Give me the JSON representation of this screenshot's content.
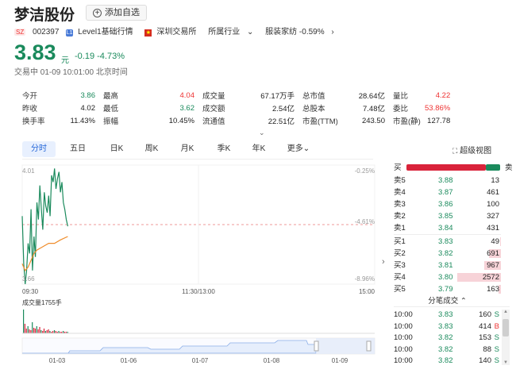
{
  "header": {
    "title": "梦洁股份",
    "watch_label": "添加自选",
    "market_tag": "SZ",
    "code": "002397",
    "level_badge": "L1",
    "level_label": "Level1基础行情",
    "exchange_label": "深圳交易所",
    "industry_label": "所属行业",
    "sector_label": "服装家纺 -0.59%"
  },
  "quote": {
    "price": "3.83",
    "unit": "元",
    "change": "-0.19  -4.73%",
    "timestamp": "交易中 01-09 10:01:00 北京时间"
  },
  "stats": [
    [
      {
        "l": "今开",
        "v": "3.86",
        "c": "grn"
      },
      {
        "l": "最高",
        "v": "4.04",
        "c": "red"
      },
      {
        "l": "成交量",
        "v": "67.17万手",
        "c": ""
      },
      {
        "l": "总市值",
        "v": "28.64亿",
        "c": ""
      },
      {
        "l": "量比",
        "v": "4.22",
        "c": "red"
      }
    ],
    [
      {
        "l": "昨收",
        "v": "4.02",
        "c": ""
      },
      {
        "l": "最低",
        "v": "3.62",
        "c": "grn"
      },
      {
        "l": "成交额",
        "v": "2.54亿",
        "c": ""
      },
      {
        "l": "总股本",
        "v": "7.48亿",
        "c": ""
      },
      {
        "l": "委比",
        "v": "53.86%",
        "c": "red"
      }
    ],
    [
      {
        "l": "换手率",
        "v": "11.43%",
        "c": ""
      },
      {
        "l": "振幅",
        "v": "10.45%",
        "c": ""
      },
      {
        "l": "流通值",
        "v": "22.51亿",
        "c": ""
      },
      {
        "l": "市盈(TTM)",
        "v": "243.50",
        "c": ""
      },
      {
        "l": "市盈(静)",
        "v": "127.78",
        "c": ""
      }
    ]
  ],
  "tabs": [
    "分时",
    "五日",
    "日K",
    "周K",
    "月K",
    "季K",
    "年K",
    "更多"
  ],
  "super_chart_label": "超级视图",
  "chart": {
    "y_top": "4.01",
    "y_bottom": "3.66",
    "pct_top": "-0.25%",
    "pct_mid": "-4.61%",
    "pct_bottom": "-8.96%",
    "x_start": "09:30",
    "x_mid": "11:30/13:00",
    "x_end": "15:00",
    "volume_label": "成交量1755手",
    "nav_dates": [
      "01-03",
      "01-06",
      "01-07",
      "01-08",
      "01-09"
    ]
  },
  "chart_data": {
    "type": "line",
    "series": [
      {
        "color": "#1a8a5c",
        "x": [
          "09:30",
          "09:31",
          "09:32",
          "09:33",
          "09:34",
          "09:35",
          "09:36",
          "09:37",
          "09:38",
          "09:39",
          "09:40",
          "09:41",
          "09:42",
          "09:43",
          "09:44",
          "09:45",
          "09:46",
          "09:47",
          "09:48",
          "09:49",
          "09:50",
          "09:51",
          "09:52",
          "09:53",
          "09:54",
          "09:55",
          "09:56",
          "09:57",
          "09:58",
          "09:59",
          "10:00",
          "10:01"
        ],
        "values": [
          3.86,
          3.72,
          3.66,
          3.7,
          3.78,
          3.75,
          3.88,
          3.7,
          3.8,
          3.74,
          3.9,
          3.85,
          3.95,
          3.88,
          3.82,
          3.93,
          3.89,
          3.87,
          3.92,
          3.86,
          3.98,
          3.96,
          4.0,
          3.94,
          3.97,
          3.99,
          3.93,
          3.96,
          3.9,
          3.88,
          3.85,
          3.83
        ]
      },
      {
        "color": "#f08c2a",
        "x": [
          "09:30",
          "09:32",
          "09:34",
          "09:36",
          "09:38",
          "09:40",
          "09:44",
          "09:48",
          "09:52",
          "09:56",
          "10:01"
        ],
        "values": [
          3.72,
          3.7,
          3.71,
          3.73,
          3.75,
          3.76,
          3.77,
          3.78,
          3.78,
          3.79,
          3.8
        ]
      }
    ],
    "ylim": [
      3.66,
      4.01
    ]
  },
  "order_book": {
    "header_left": "买",
    "header_right": "卖",
    "asks": [
      {
        "label": "卖5",
        "price": "3.88",
        "vol": "13"
      },
      {
        "label": "卖4",
        "price": "3.87",
        "vol": "461"
      },
      {
        "label": "卖3",
        "price": "3.86",
        "vol": "100"
      },
      {
        "label": "卖2",
        "price": "3.85",
        "vol": "327"
      },
      {
        "label": "卖1",
        "price": "3.84",
        "vol": "431"
      }
    ],
    "bids": [
      {
        "label": "买1",
        "price": "3.83",
        "vol": "49"
      },
      {
        "label": "买2",
        "price": "3.82",
        "vol": "691"
      },
      {
        "label": "买3",
        "price": "3.81",
        "vol": "967"
      },
      {
        "label": "买4",
        "price": "3.80",
        "vol": "2572"
      },
      {
        "label": "买5",
        "price": "3.79",
        "vol": "163"
      }
    ]
  },
  "trades": {
    "header": "分笔成交",
    "rows": [
      {
        "t": "10:00",
        "p": "3.83",
        "v": "160",
        "s": "S"
      },
      {
        "t": "10:00",
        "p": "3.83",
        "v": "414",
        "s": "B"
      },
      {
        "t": "10:00",
        "p": "3.82",
        "v": "153",
        "s": "S"
      },
      {
        "t": "10:00",
        "p": "3.82",
        "v": "88",
        "s": "S"
      },
      {
        "t": "10:00",
        "p": "3.82",
        "v": "140",
        "s": "S"
      }
    ]
  }
}
